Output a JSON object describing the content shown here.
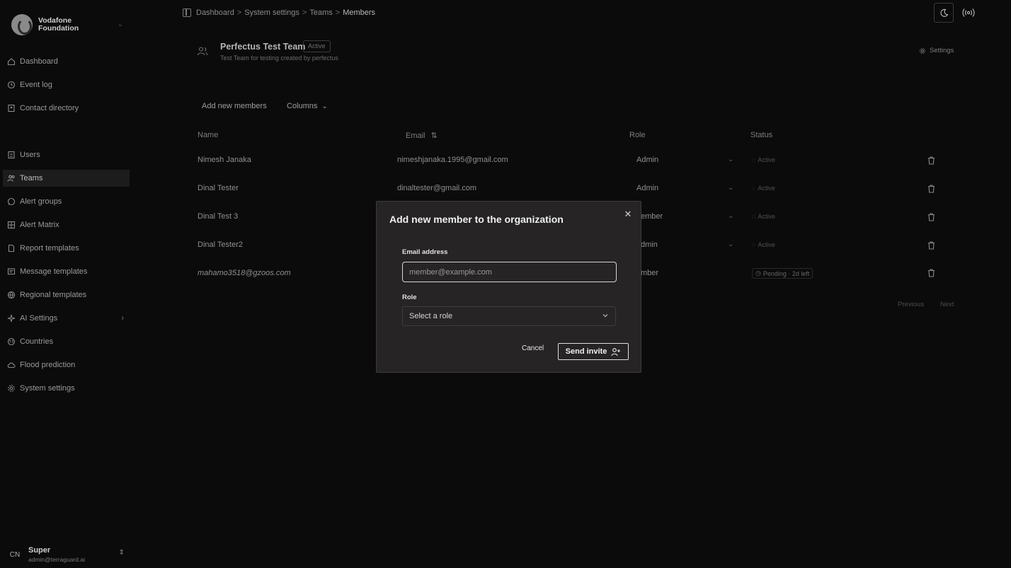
{
  "sidebar": {
    "brand": {
      "line1": "Vodafone",
      "line2": "Foundation"
    },
    "items": [
      {
        "label": "Dashboard",
        "icon": "home-icon"
      },
      {
        "label": "Event log",
        "icon": "history-icon"
      },
      {
        "label": "Contact directory",
        "icon": "contact-book-icon"
      },
      {
        "label": "Users",
        "icon": "users-icon"
      },
      {
        "label": "Teams",
        "icon": "team-icon"
      },
      {
        "label": "Alert groups",
        "icon": "chat-icon"
      },
      {
        "label": "Alert Matrix",
        "icon": "grid-icon"
      },
      {
        "label": "Report templates",
        "icon": "report-icon"
      },
      {
        "label": "Message templates",
        "icon": "message-icon"
      },
      {
        "label": "Regional templates",
        "icon": "globe-icon"
      },
      {
        "label": "AI Settings",
        "icon": "sparkle-icon"
      },
      {
        "label": "Countries",
        "icon": "earth-icon"
      },
      {
        "label": "Flood prediction",
        "icon": "cloud-icon"
      },
      {
        "label": "System settings",
        "icon": "gear-icon"
      }
    ],
    "user": {
      "initials": "CN",
      "name": "Super",
      "email": "admin@terraguard.ai"
    }
  },
  "breadcrumb": [
    "Dashboard",
    "System settings",
    "Teams",
    "Members"
  ],
  "team": {
    "name": "Perfectus Test Team",
    "badge": "Active",
    "description": "Test Team for testing created by perfectus",
    "settings_label": "Settings"
  },
  "toolbar": {
    "add_label": "Add new members",
    "columns_label": "Columns"
  },
  "table": {
    "headers": {
      "name": "Name",
      "email": "Email",
      "role": "Role",
      "status": "Status"
    },
    "rows": [
      {
        "name": "Nimesh Janaka",
        "email": "nimeshjanaka.1995@gmail.com",
        "role": "Admin",
        "status": "Active"
      },
      {
        "name": "Dinal Tester",
        "email": "dinaltester@gmail.com",
        "role": "Admin",
        "status": "Active"
      },
      {
        "name": "Dinal Test 3",
        "email": "",
        "role": "ember",
        "status": "Active"
      },
      {
        "name": "Dinal Tester2",
        "email": "",
        "role": "dmin",
        "status": "Active"
      },
      {
        "name": "mahamo3518@gzoos.com",
        "email": "",
        "role": "mber",
        "status": "Pending · 2d left"
      }
    ],
    "pager": {
      "previous": "Previous",
      "next": "Next"
    }
  },
  "dialog": {
    "title": "Add new member to the organization",
    "email_label": "Email address",
    "email_placeholder": "member@example.com",
    "role_label": "Role",
    "role_placeholder": "Select a role",
    "cancel_label": "Cancel",
    "send_label": "Send invite"
  }
}
